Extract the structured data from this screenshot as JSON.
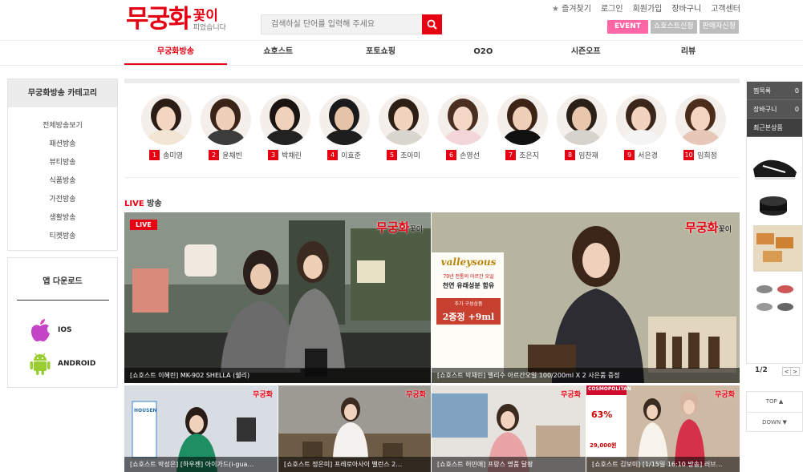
{
  "header": {
    "logo_main": "무궁화",
    "logo_sub1": "꽃이",
    "logo_sub2": "피었습니다",
    "bookmark": "즐겨찾기",
    "login": "로그인",
    "signup": "회원가입",
    "cart": "장바구니",
    "support": "고객센터",
    "search_placeholder": "검색하실 단어를 입력해 주세요",
    "event_btn": "EVENT",
    "show_apply": "쇼호스트신청",
    "seller_apply": "판매자신청"
  },
  "nav": [
    "무궁화방송",
    "쇼호스트",
    "포토쇼핑",
    "O2O",
    "시즌오프",
    "리뷰"
  ],
  "sidebar": {
    "title": "무궁화방송 카테고리",
    "items": [
      "전체방송보기",
      "패션방송",
      "뷰티방송",
      "식품방송",
      "가전방송",
      "생활방송",
      "티켓방송"
    ],
    "app_title": "앱 다운로드",
    "ios": "IOS",
    "android": "ANDROID"
  },
  "hosts": [
    {
      "num": "1",
      "name": "송미영"
    },
    {
      "num": "2",
      "name": "윤채빈"
    },
    {
      "num": "3",
      "name": "박채린"
    },
    {
      "num": "4",
      "name": "이효준"
    },
    {
      "num": "5",
      "name": "조아미"
    },
    {
      "num": "6",
      "name": "손영선"
    },
    {
      "num": "7",
      "name": "조은지"
    },
    {
      "num": "8",
      "name": "임찬재"
    },
    {
      "num": "9",
      "name": "서은경"
    },
    {
      "num": "10",
      "name": "임희정"
    }
  ],
  "live": {
    "title_live": "LIVE",
    "title_rest": " 방송",
    "badge": "LIVE",
    "watermark_main": "무궁화",
    "watermark_sub": "꽃이",
    "tiles": [
      "[쇼호스트 이혜린] MK-902 SHELLA (쉘리)",
      "[쇼호스트 박채린] 밸리수 아르간오일 100/200ml X 2 사은품 증정",
      "[쇼호스트 박성은] [하우젠] 아이가드(i-gua…",
      "[쇼호스트 정은미] 프레로아사이 밸런스 2…",
      "[쇼호스트 허민애] 프랑스 명품 달팡",
      "[쇼호스트 김보미] [1/15일 16:10 방송] 러브…"
    ],
    "ad": {
      "brand": "valleysous",
      "line1": "70년 전통의 아르간 오일",
      "line2": "천연 유래성분 함유",
      "line3": "추가 구성상품",
      "line4": "2증정 +9ml"
    },
    "cosmo": {
      "brand": "COSMOPOLITAN",
      "pct": "63%",
      "price": "29,000원"
    },
    "housen": "HOUSEN"
  },
  "quickbar": {
    "wishlist": "찜목록",
    "wishlist_count": "0",
    "cart": "장바구니",
    "cart_count": "0",
    "recent": "최근본상품",
    "page": "1/2",
    "prev": "<",
    "next": ">",
    "top": "TOP ▲",
    "down": "DOWN ▼"
  },
  "colors": {
    "brand": "#e60012",
    "event": "#ff66a6"
  }
}
